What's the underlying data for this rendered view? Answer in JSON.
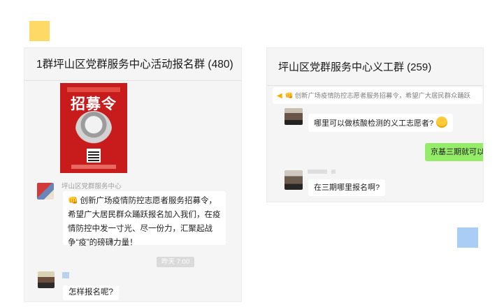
{
  "panel1": {
    "title": "1群坪山区党群服务中心活动报名群 (480)",
    "poster": {
      "title": "招募令"
    },
    "message1": {
      "sender": "坪山区党群服务中心",
      "icon": "megaphone-emoji-icon",
      "text": "👊 创新广场疫情防控志愿者服务招募令，希望广大居民群众踊跃报名加入我们，在疫情防控中发一寸光、尽一份力，汇聚起战争“疫”的磅礴力量！"
    },
    "timestamp": "昨天 7:00",
    "message2": {
      "text": "怎样报名呢?"
    }
  },
  "panel2": {
    "title": "坪山区党群服务中心义工群 (259)",
    "notice": {
      "icon": "speaker-icon",
      "text": "👊 创新广场疫情防控志愿者服务招募令，希望广大居民群众踊跃"
    },
    "message1": {
      "text": "哪里可以做核酸检测的义工志愿者?",
      "icon": "smile-emoji-icon"
    },
    "message2": {
      "text": "京基三期就可以"
    },
    "message3": {
      "text": "在三期哪里报名啊?"
    }
  },
  "colors": {
    "deco_yellow": "#fed965",
    "deco_blue": "#a9cdf5",
    "poster_red": "#c81b1b",
    "self_bubble_green": "#95ec69"
  }
}
